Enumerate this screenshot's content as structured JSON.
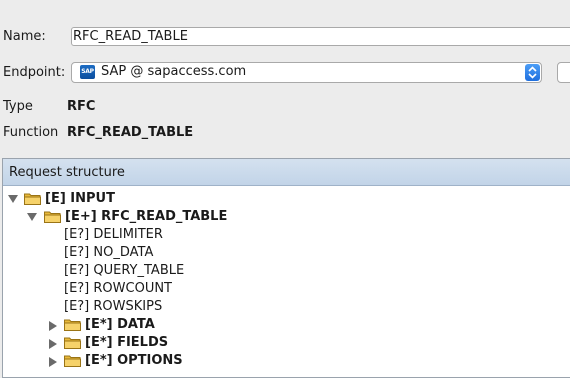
{
  "form": {
    "name_label": "Name:",
    "name_value": "RFC_READ_TABLE",
    "endpoint_label": "Endpoint:",
    "endpoint_value": "SAP @ sapaccess.com",
    "endpoint_icon": "sap-logo-icon",
    "type_label": "Type",
    "type_value": "RFC",
    "function_label": "Function",
    "function_value": "RFC_READ_TABLE"
  },
  "panel": {
    "title": "Request structure"
  },
  "tree": [
    {
      "label": "[E] INPUT",
      "expanded": true,
      "folder": true,
      "bold": true
    },
    {
      "label": "[E+] RFC_READ_TABLE",
      "expanded": true,
      "folder": true,
      "bold": true
    },
    {
      "label": "[E?] DELIMITER",
      "folder": false,
      "bold": false
    },
    {
      "label": "[E?] NO_DATA",
      "folder": false,
      "bold": false
    },
    {
      "label": "[E?] QUERY_TABLE",
      "folder": false,
      "bold": false
    },
    {
      "label": "[E?] ROWCOUNT",
      "folder": false,
      "bold": false
    },
    {
      "label": "[E?] ROWSKIPS",
      "folder": false,
      "bold": false
    },
    {
      "label": "[E*] DATA",
      "expanded": false,
      "folder": true,
      "bold": true
    },
    {
      "label": "[E*] FIELDS",
      "expanded": false,
      "folder": true,
      "bold": true
    },
    {
      "label": "[E*] OPTIONS",
      "expanded": false,
      "folder": true,
      "bold": true
    }
  ],
  "colors": {
    "panel_header": "#c8d8eb",
    "folder": "#e8b93a",
    "select_stepper": "#2f7fe8"
  }
}
